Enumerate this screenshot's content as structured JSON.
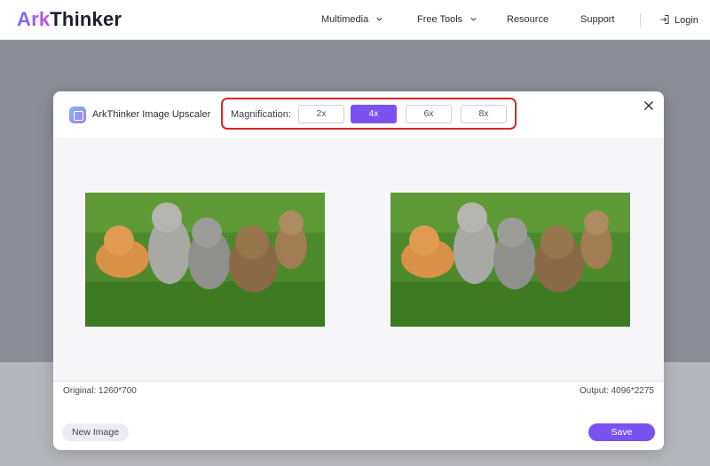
{
  "brand": {
    "logo_mark": "Ark",
    "logo_rest": "Thinker"
  },
  "nav": {
    "items": [
      {
        "label": "Multimedia",
        "has_dropdown": true
      },
      {
        "label": "Free Tools",
        "has_dropdown": true
      },
      {
        "label": "Resource",
        "has_dropdown": false
      },
      {
        "label": "Support",
        "has_dropdown": false
      }
    ],
    "login_label": "Login",
    "login_icon": "login-icon"
  },
  "modal": {
    "title": "ArkThinker Image Upscaler",
    "app_icon": "image-upscaler-icon",
    "magnification_label": "Magnification:",
    "magnification_options": [
      "2x",
      "4x",
      "6x",
      "8x"
    ],
    "selected_magnification": "4x",
    "close_icon": "close-icon",
    "original_info": "Original: 1260*700",
    "output_info": "Output: 4096*2275",
    "new_image_label": "New Image",
    "save_label": "Save"
  },
  "colors": {
    "accent": "#7a52f4",
    "highlight_border": "#d8262c",
    "overlay": "#8a8c96"
  }
}
